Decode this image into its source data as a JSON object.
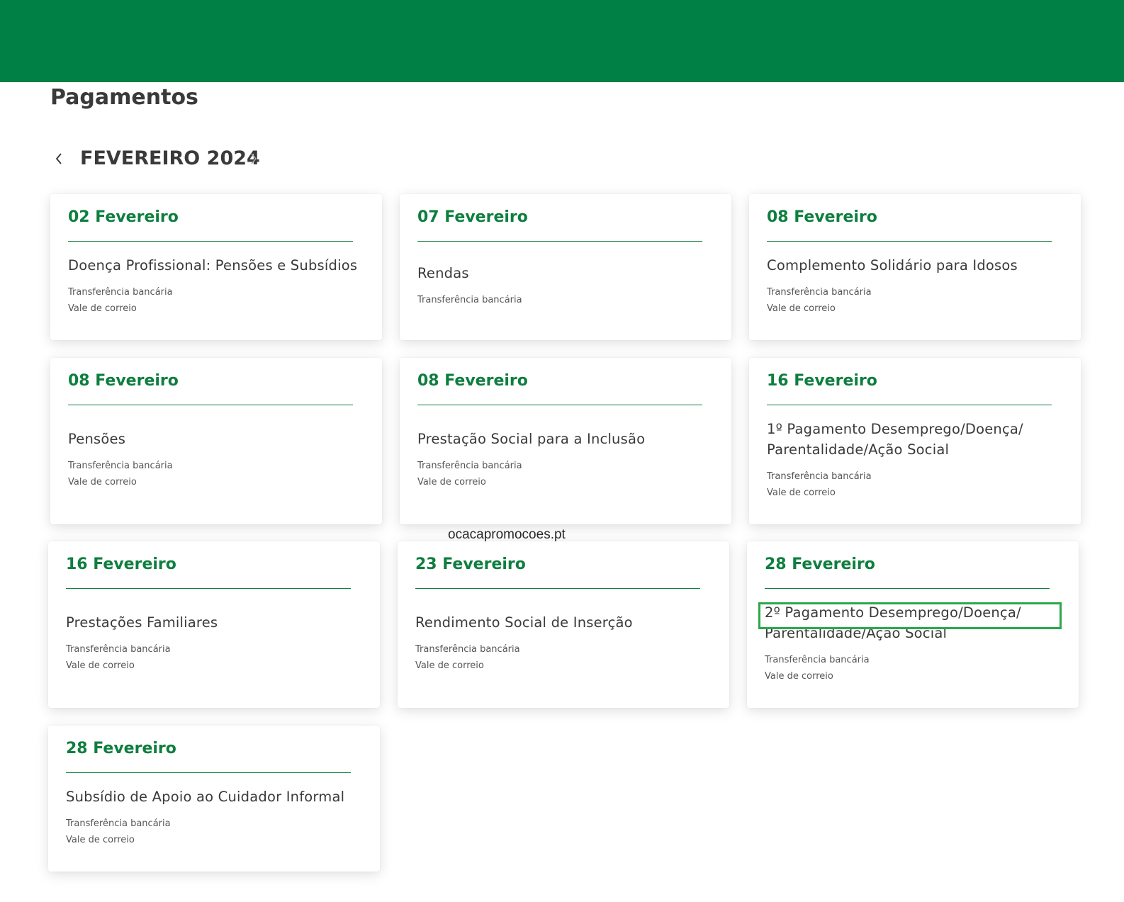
{
  "page": {
    "title": "Pagamentos",
    "month_label": "FEVEREIRO 2024",
    "prev_icon": "chevron-left-icon",
    "next_icon": "chevron-right-icon",
    "watermark": "ocacapromocoes.pt"
  },
  "colors": {
    "brand_green": "#008044",
    "date_green": "#0e7e3f",
    "highlight": "#2aa84a"
  },
  "cards": [
    {
      "date": "02 Fevereiro",
      "title": "Doença Profissional: Pensões e Subsídios",
      "methods": [
        "Transferência bancária",
        "Vale de correio"
      ]
    },
    {
      "date": "07 Fevereiro",
      "title": "Rendas",
      "methods": [
        "Transferência bancária"
      ]
    },
    {
      "date": "08 Fevereiro",
      "title": "Complemento Solidário para Idosos",
      "methods": [
        "Transferência bancária",
        "Vale de correio"
      ]
    },
    {
      "date": "08 Fevereiro",
      "title": "Pensões",
      "methods": [
        "Transferência bancária",
        "Vale de correio"
      ]
    },
    {
      "date": "08 Fevereiro",
      "title": "Prestação Social para a Inclusão",
      "methods": [
        "Transferência bancária",
        "Vale de correio"
      ]
    },
    {
      "date": "16 Fevereiro",
      "title": "1º Pagamento Desemprego/Doença/ Parentalidade/Ação Social",
      "methods": [
        "Transferência bancária",
        "Vale de correio"
      ]
    },
    {
      "date": "16 Fevereiro",
      "title": "Prestações Familiares",
      "methods": [
        "Transferência bancária",
        "Vale de correio"
      ]
    },
    {
      "date": "23 Fevereiro",
      "title": "Rendimento Social de Inserção",
      "methods": [
        "Transferência bancária",
        "Vale de correio"
      ]
    },
    {
      "date": "28 Fevereiro",
      "title": "2º Pagamento Desemprego/Doença/ Parentalidade/Ação Social",
      "methods": [
        "Transferência bancária",
        "Vale de correio"
      ]
    },
    {
      "date": "28 Fevereiro",
      "title": "Subsídio de Apoio ao Cuidador Informal",
      "methods": [
        "Transferência bancária",
        "Vale de correio"
      ]
    }
  ]
}
